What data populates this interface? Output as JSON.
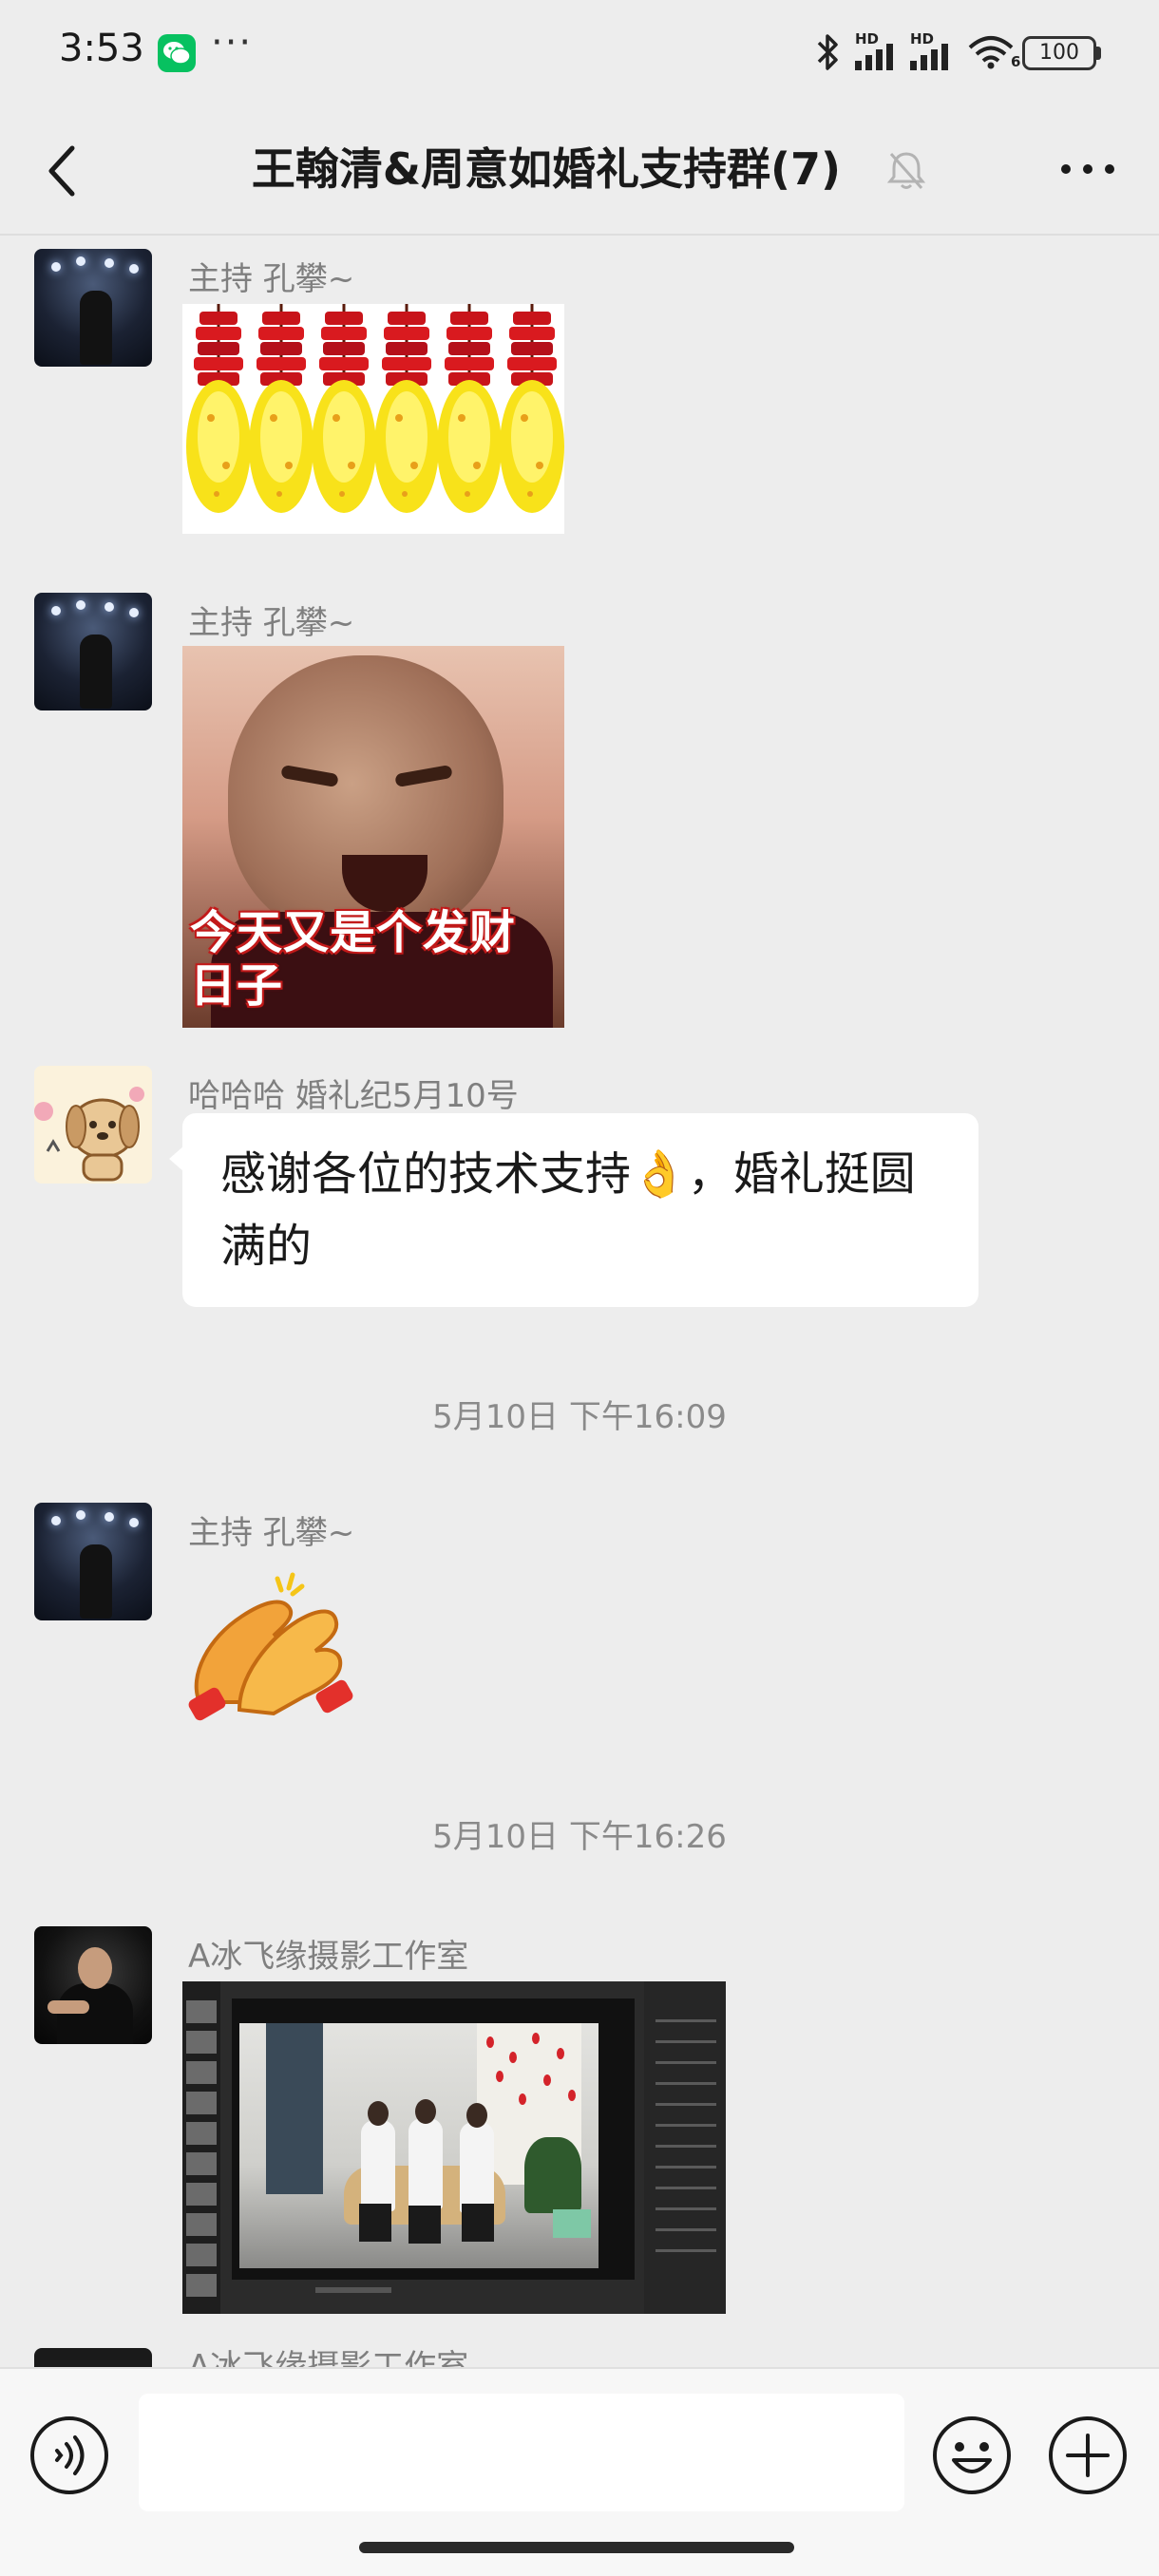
{
  "status_bar": {
    "time": "3:53",
    "more": "···",
    "hd_1": "HD",
    "hd_2": "HD",
    "wifi_band": "6",
    "battery": "100"
  },
  "header": {
    "title": "王翰清&周意如婚礼支持群(7)"
  },
  "messages": [
    {
      "sender": "主持 孔攀~",
      "type": "sticker",
      "sticker": "firecrackers"
    },
    {
      "sender": "主持 孔攀~",
      "type": "sticker",
      "sticker": "laughing-baby",
      "caption": "今天又是个发财日子"
    },
    {
      "sender": "哈哈哈  婚礼纪5月10号",
      "type": "text",
      "text": "感谢各位的技术支持👌，婚礼挺圆满的"
    },
    {
      "type": "timestamp",
      "text": "5月10日 下午16:09"
    },
    {
      "sender": "主持 孔攀~",
      "type": "sticker",
      "sticker": "clapping-hands"
    },
    {
      "type": "timestamp",
      "text": "5月10日 下午16:26"
    },
    {
      "sender": "A冰飞缘摄影工作室",
      "type": "image",
      "image": "photo-editor-screenshot"
    },
    {
      "sender": "A冰飞缘摄影工作室",
      "type": "partial"
    }
  ],
  "input": {
    "value": ""
  },
  "colors": {
    "background": "#ededed",
    "bubble": "#ffffff",
    "brand": "#07c160"
  },
  "icons": [
    "back-icon",
    "mute-bell-icon",
    "more-icon",
    "voice-icon",
    "emoji-icon",
    "plus-icon",
    "bluetooth-icon",
    "signal-icon",
    "wifi-icon",
    "battery-icon"
  ]
}
